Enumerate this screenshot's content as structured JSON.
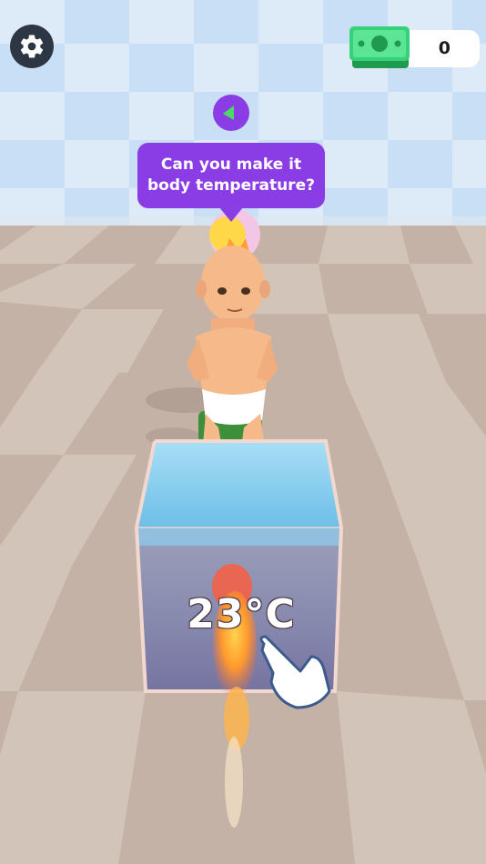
{
  "hud": {
    "settings_icon": "gear-icon",
    "money_icon": "cash-stack-icon",
    "money_value": "0"
  },
  "dialog": {
    "icon": "play-triangle-icon",
    "text": "Can you make it body temperature?"
  },
  "tank": {
    "temperature": "23°C"
  },
  "colors": {
    "accent_purple": "#8b3de5",
    "hud_dark": "#2d3744",
    "money_green": "#2ecc71",
    "water_blue": "#8fd4f2"
  }
}
